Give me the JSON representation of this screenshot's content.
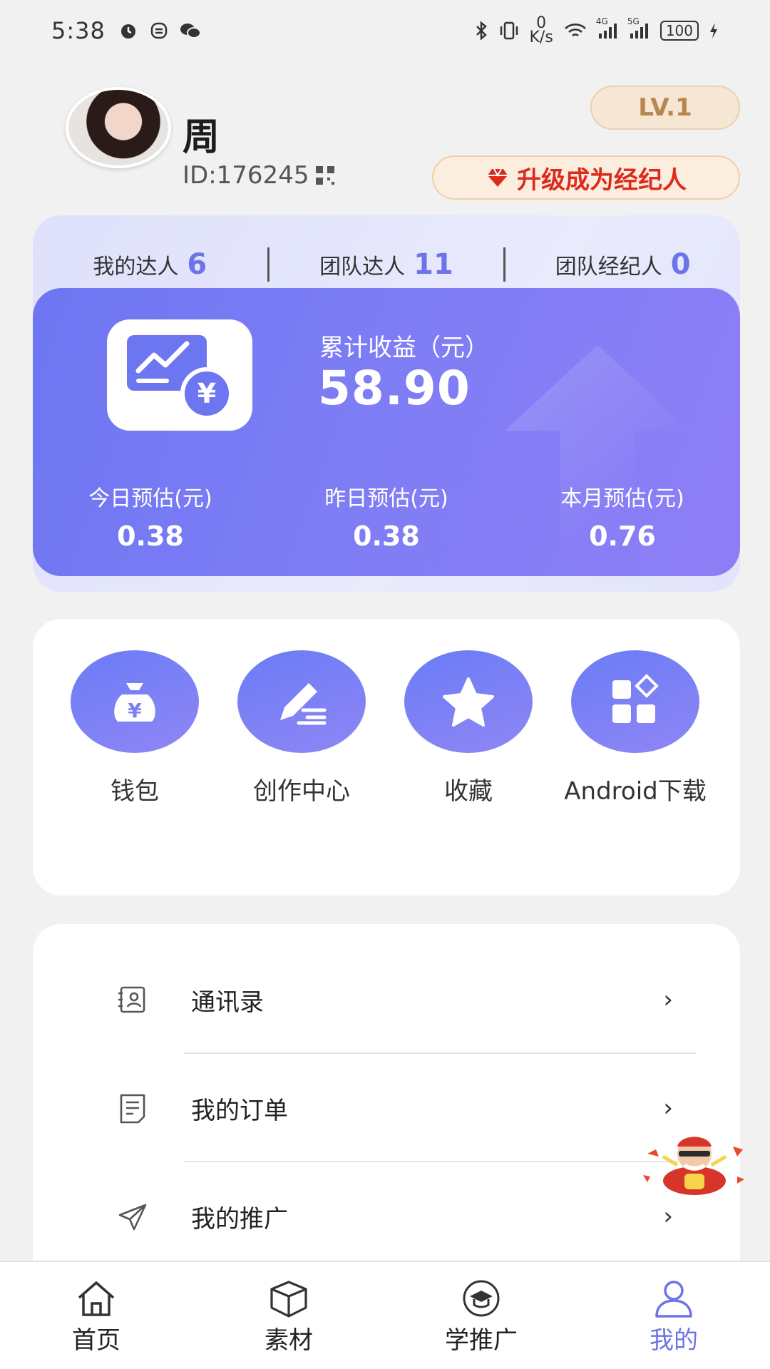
{
  "status_bar": {
    "time": "5:38",
    "net_speed": "0\nK/s",
    "net_speed_top": "0",
    "net_speed_unit": "K/s",
    "signal_1": "4G",
    "signal_2": "5G",
    "battery": "100"
  },
  "profile": {
    "name": "周",
    "id_text": "ID:176245",
    "level": "LV.1",
    "upgrade_label": "升级成为经纪人"
  },
  "team": [
    {
      "label": "我的达人",
      "value": "6"
    },
    {
      "label": "团队达人",
      "value": "11"
    },
    {
      "label": "团队经纪人",
      "value": "0"
    }
  ],
  "earnings": {
    "total_label": "累计收益（元）",
    "total_value": "58.90",
    "today_label": "今日预估(元)",
    "today_value": "0.38",
    "yesterday_label": "昨日预估(元)",
    "yesterday_value": "0.38",
    "month_label": "本月预估(元)",
    "month_value": "0.76"
  },
  "functions": [
    {
      "label": "钱包",
      "icon": "money-bag-icon"
    },
    {
      "label": "创作中心",
      "icon": "pen-icon"
    },
    {
      "label": "收藏",
      "icon": "star-icon"
    },
    {
      "label": "Android下载",
      "icon": "apps-icon"
    }
  ],
  "menu": [
    {
      "label": "通讯录",
      "icon": "contacts-icon"
    },
    {
      "label": "我的订单",
      "icon": "order-icon"
    },
    {
      "label": "我的推广",
      "icon": "send-icon"
    }
  ],
  "tabs": [
    {
      "label": "首页",
      "icon": "home-icon"
    },
    {
      "label": "素材",
      "icon": "box-icon"
    },
    {
      "label": "学推广",
      "icon": "graduation-icon"
    },
    {
      "label": "我的",
      "icon": "user-icon",
      "active": true
    }
  ],
  "colors": {
    "accent": "#6d73e9",
    "card_gradient_start": "#6d76f1",
    "card_gradient_end": "#8f7ef6",
    "upgrade_text": "#dd2a1c",
    "level_text": "#b8864e"
  }
}
